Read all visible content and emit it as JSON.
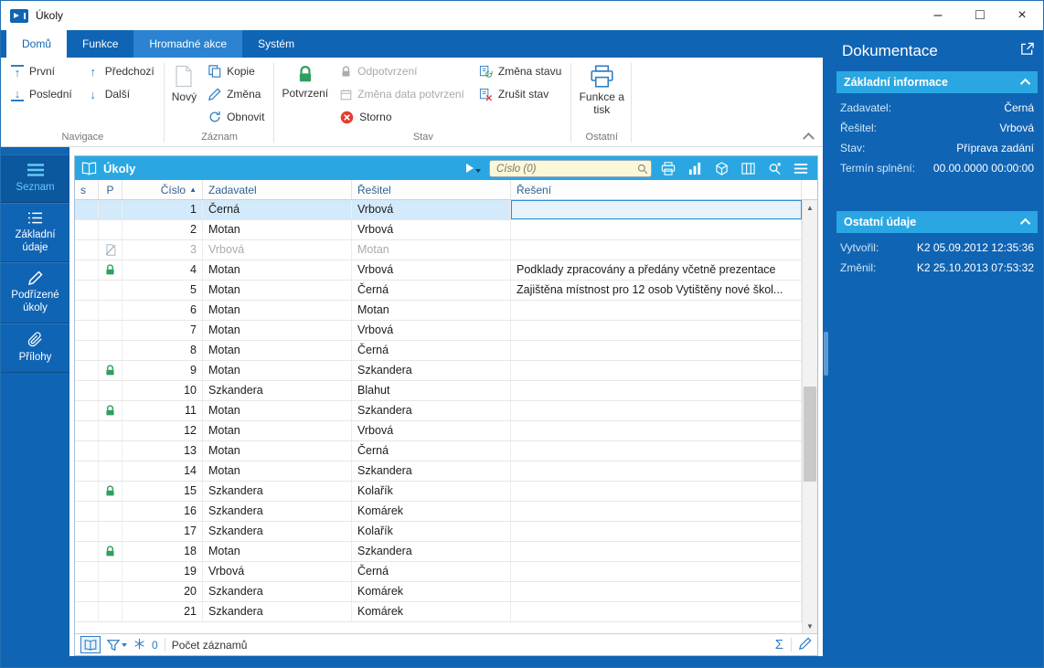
{
  "window": {
    "title": "Úkoly",
    "controls": {
      "minimize": "–",
      "maximize": "□",
      "close": "×"
    }
  },
  "tabs": [
    {
      "label": "Domů",
      "active": true
    },
    {
      "label": "Funkce",
      "active": false
    },
    {
      "label": "Hromadné akce",
      "active": false,
      "highlighted": true
    },
    {
      "label": "Systém",
      "active": false
    }
  ],
  "ribbon": {
    "navigace": {
      "group_label": "Navigace",
      "first": "První",
      "last": "Poslední",
      "prev": "Předchozí",
      "next": "Další",
      "arrow_up": "↑",
      "arrow_down": "↓"
    },
    "zaznam": {
      "group_label": "Záznam",
      "new": "Nový",
      "copy": "Kopie",
      "change": "Změna",
      "refresh": "Obnovit"
    },
    "stav": {
      "group_label": "Stav",
      "confirm": "Potvrzení",
      "unconfirm": "Odpotvrzení",
      "change_confirm_date": "Změna data potvrzení",
      "storno": "Storno",
      "change_status": "Změna stavu",
      "clear_status": "Zrušit stav"
    },
    "ostatni": {
      "group_label": "Ostatní",
      "functions_print": "Funkce a tisk"
    }
  },
  "sidebar": {
    "items": [
      {
        "label": "Seznam",
        "active": true
      },
      {
        "label": "Základní údaje",
        "active": false
      },
      {
        "label": "Podřízené úkoly",
        "active": false
      },
      {
        "label": "Přílohy",
        "active": false
      }
    ]
  },
  "table": {
    "title": "Úkoly",
    "search_placeholder": "Číslo (0)",
    "sort_indicator": "▲",
    "scroll_up_glyph": "▲",
    "scroll_down_glyph": "▼",
    "columns": [
      "s",
      "P",
      "Číslo",
      "Zadavatel",
      "Řešitel",
      "Řešení"
    ],
    "rows": [
      {
        "cislo": 1,
        "p": "",
        "zadavatel": "Černá",
        "resitel": "Vrbová",
        "reseni": "",
        "selected": true
      },
      {
        "cislo": 2,
        "p": "",
        "zadavatel": "Motan",
        "resitel": "Vrbová",
        "reseni": ""
      },
      {
        "cislo": 3,
        "p": "storno",
        "zadavatel": "Vrbová",
        "resitel": "Motan",
        "reseni": "",
        "muted": true
      },
      {
        "cislo": 4,
        "p": "lock",
        "zadavatel": "Motan",
        "resitel": "Vrbová",
        "reseni": "Podklady zpracovány a předány včetně prezentace"
      },
      {
        "cislo": 5,
        "p": "",
        "zadavatel": "Motan",
        "resitel": "Černá",
        "reseni": "Zajištěna místnost pro 12 osob Vytištěny nové škol..."
      },
      {
        "cislo": 6,
        "p": "",
        "zadavatel": "Motan",
        "resitel": "Motan",
        "reseni": ""
      },
      {
        "cislo": 7,
        "p": "",
        "zadavatel": "Motan",
        "resitel": "Vrbová",
        "reseni": ""
      },
      {
        "cislo": 8,
        "p": "",
        "zadavatel": "Motan",
        "resitel": "Černá",
        "reseni": ""
      },
      {
        "cislo": 9,
        "p": "lock",
        "zadavatel": "Motan",
        "resitel": "Szkandera",
        "reseni": ""
      },
      {
        "cislo": 10,
        "p": "",
        "zadavatel": "Szkandera",
        "resitel": "Blahut",
        "reseni": ""
      },
      {
        "cislo": 11,
        "p": "lock",
        "zadavatel": "Motan",
        "resitel": "Szkandera",
        "reseni": ""
      },
      {
        "cislo": 12,
        "p": "",
        "zadavatel": "Motan",
        "resitel": "Vrbová",
        "reseni": ""
      },
      {
        "cislo": 13,
        "p": "",
        "zadavatel": "Motan",
        "resitel": "Černá",
        "reseni": ""
      },
      {
        "cislo": 14,
        "p": "",
        "zadavatel": "Motan",
        "resitel": "Szkandera",
        "reseni": ""
      },
      {
        "cislo": 15,
        "p": "lock",
        "zadavatel": "Szkandera",
        "resitel": "Kolařík",
        "reseni": ""
      },
      {
        "cislo": 16,
        "p": "",
        "zadavatel": "Szkandera",
        "resitel": "Komárek",
        "reseni": ""
      },
      {
        "cislo": 17,
        "p": "",
        "zadavatel": "Szkandera",
        "resitel": "Kolařík",
        "reseni": ""
      },
      {
        "cislo": 18,
        "p": "lock",
        "zadavatel": "Motan",
        "resitel": "Szkandera",
        "reseni": ""
      },
      {
        "cislo": 19,
        "p": "",
        "zadavatel": "Vrbová",
        "resitel": "Černá",
        "reseni": ""
      },
      {
        "cislo": 20,
        "p": "",
        "zadavatel": "Szkandera",
        "resitel": "Komárek",
        "reseni": ""
      },
      {
        "cislo": 21,
        "p": "",
        "zadavatel": "Szkandera",
        "resitel": "Komárek",
        "reseni": ""
      }
    ],
    "footer": {
      "freeze_count": "0",
      "records_label": "Počet záznamů",
      "sum_glyph": "Σ"
    }
  },
  "doc_panel": {
    "title": "Dokumentace",
    "sections": [
      {
        "title": "Základní informace",
        "fields": [
          {
            "label": "Zadavatel:",
            "value": "Černá"
          },
          {
            "label": "Řešitel:",
            "value": "Vrbová"
          },
          {
            "label": "Stav:",
            "value": "Příprava zadání"
          },
          {
            "label": "Termín splnění:",
            "value": "00.00.0000 00:00:00"
          }
        ]
      },
      {
        "title": "Ostatní údaje",
        "fields": [
          {
            "label": "Vytvořil:",
            "value": "K2 05.09.2012 12:35:36"
          },
          {
            "label": "Změnil:",
            "value": "K2 25.10.2013 07:53:32"
          }
        ]
      }
    ]
  },
  "colors": {
    "primary_blue": "#1064b4",
    "accent_cyan": "#2aa7e2",
    "confirmed_green": "#2f9e5f",
    "storno_red": "#e23d2e",
    "selection_blue": "#d3eafb"
  }
}
